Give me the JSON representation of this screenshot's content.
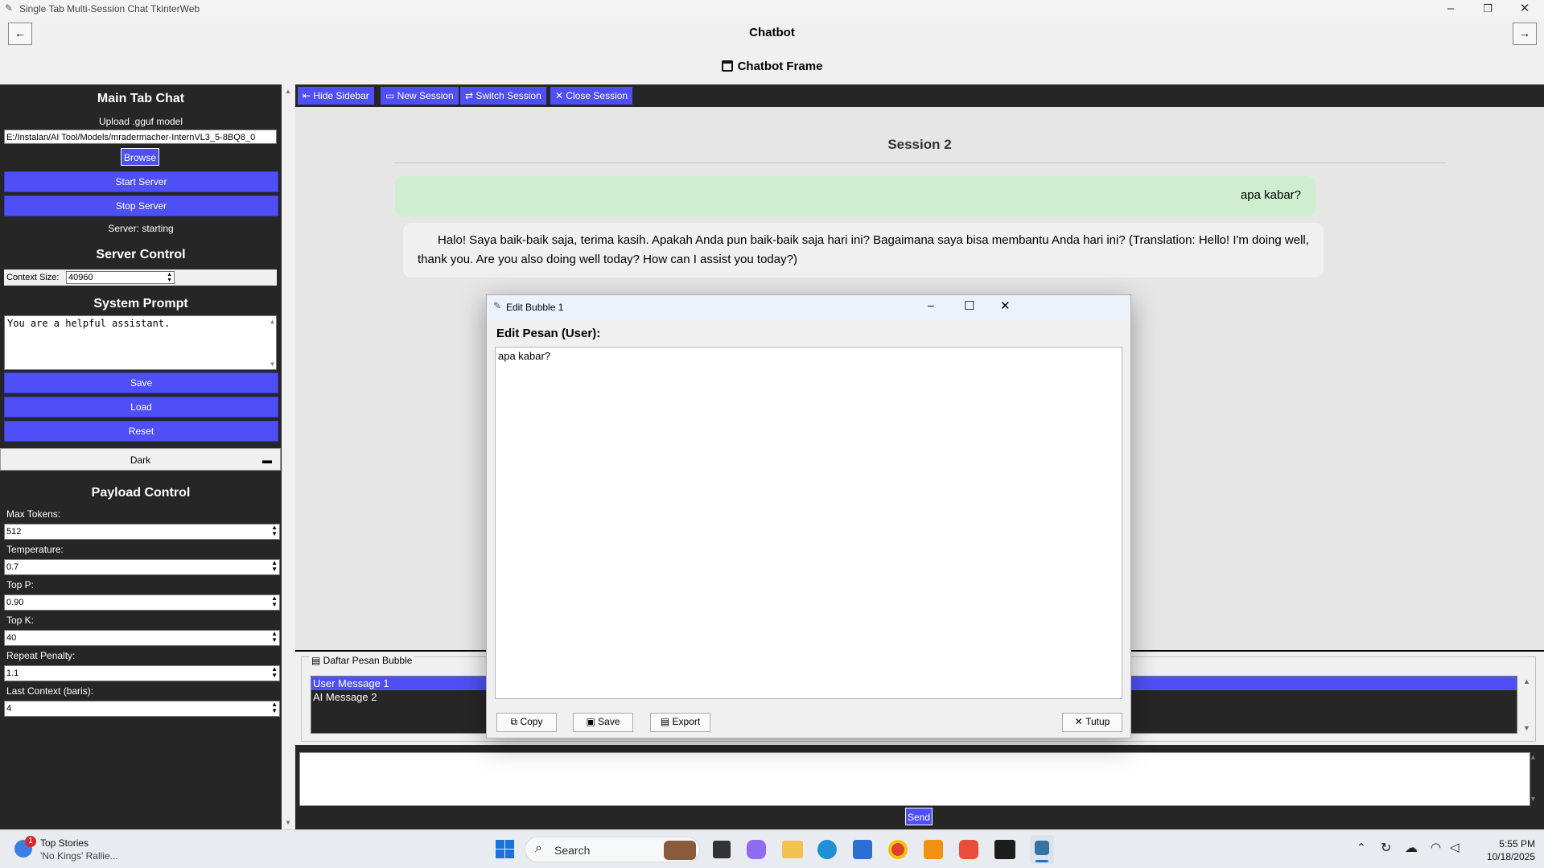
{
  "window": {
    "title": "Single Tab Multi-Session Chat TkinterWeb",
    "controls": [
      "–",
      "❐",
      "✕"
    ]
  },
  "header": {
    "back_label": "←",
    "forward_label": "→",
    "title": "Chatbot",
    "frame_title": "Chatbot Frame",
    "frame_icon": "window-icon"
  },
  "sidebar": {
    "main_title": "Main Tab Chat",
    "upload_label": "Upload .gguf model",
    "model_path": "E:/Instalan/AI Tool/Models/mradermacher-InternVL3_5-8BQ8_0",
    "browse_label": "Browse",
    "start_server_label": "Start Server",
    "stop_server_label": "Stop Server",
    "server_status": "Server: starting",
    "server_control_title": "Server Control",
    "context_size_label": "Context Size:",
    "context_size_value": "40960",
    "system_prompt_title": "System Prompt",
    "system_prompt_value": "You are a helpful assistant.",
    "save_label": "Save",
    "load_label": "Load",
    "reset_label": "Reset",
    "theme_value": "Dark",
    "payload_title": "Payload Control",
    "params": [
      {
        "label": "Max Tokens:",
        "value": "512"
      },
      {
        "label": "Temperature:",
        "value": "0.7"
      },
      {
        "label": "Top P:",
        "value": "0.90"
      },
      {
        "label": "Top K:",
        "value": "40"
      },
      {
        "label": "Repeat Penalty:",
        "value": "1.1"
      },
      {
        "label": "Last Context (baris):",
        "value": "4"
      }
    ]
  },
  "toolbar": {
    "hide_sidebar": "Hide Sidebar",
    "new_session": "New Session",
    "switch_session": "Switch Session",
    "close_session": "Close Session"
  },
  "chat": {
    "session_title": "Session 2",
    "user_message": "apa kabar?",
    "ai_message": "Halo! Saya baik-baik saja, terima kasih. Apakah Anda pun baik-baik saja hari ini? Bagaimana saya bisa membantu Anda hari ini? (Translation: Hello! I'm doing well, thank you. Are you also doing well today? How can I assist you today?)"
  },
  "bubble_list": {
    "title": "Daftar Pesan Bubble",
    "items": [
      "User Message 1",
      "AI Message 2"
    ],
    "selected": "User Message 1"
  },
  "send_label": "Send",
  "dialog": {
    "title": "Edit Bubble 1",
    "heading": "Edit Pesan (User):",
    "text": "apa kabar?",
    "copy_label": "Copy",
    "save_label": "Save",
    "export_label": "Export",
    "close_label": "Tutup",
    "controls": [
      "–",
      "☐",
      "✕"
    ]
  },
  "taskbar": {
    "news_badge": "1",
    "news_title": "Top Stories",
    "news_subtitle": "'No Kings' Rallie...",
    "search_placeholder": "Search",
    "time": "5:55 PM",
    "date": "10/18/2025",
    "colors": {
      "accent": "#4f4ff7",
      "user_bubble": "#cfeecf",
      "dark_bg": "#262626"
    }
  }
}
